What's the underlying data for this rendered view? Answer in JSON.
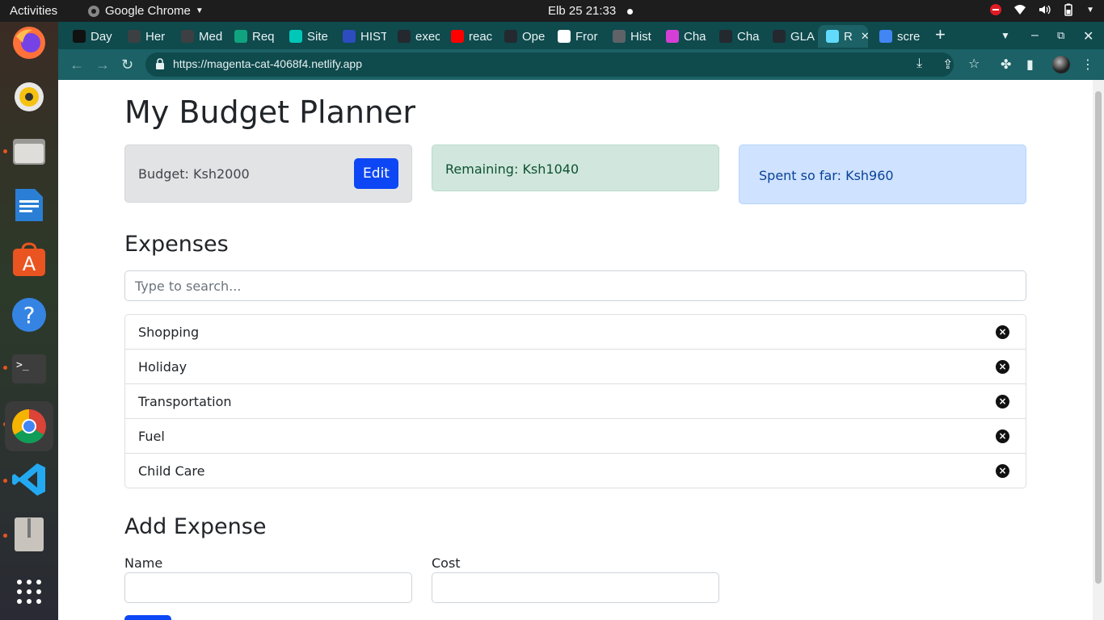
{
  "system": {
    "activities": "Activities",
    "app_name": "Google Chrome",
    "clock": "Elb 25  21:33"
  },
  "tabs": [
    {
      "label": "Day",
      "color": "#111111"
    },
    {
      "label": "Her",
      "color": "#3c4043"
    },
    {
      "label": "Med",
      "color": "#3c4043"
    },
    {
      "label": "Req",
      "color": "#10a37f"
    },
    {
      "label": "Site",
      "color": "#00c7b7"
    },
    {
      "label": "HIST",
      "color": "#2c4cbf"
    },
    {
      "label": "exec",
      "color": "#24292f"
    },
    {
      "label": "reac",
      "color": "#ff0000"
    },
    {
      "label": "Ope",
      "color": "#24292f"
    },
    {
      "label": "Fror",
      "color": "#ffffff"
    },
    {
      "label": "Hist",
      "color": "#5f6368"
    },
    {
      "label": "Cha",
      "color": "#d63fd6"
    },
    {
      "label": "Cha",
      "color": "#24292f"
    },
    {
      "label": "GLA",
      "color": "#24292f"
    },
    {
      "label": "R",
      "color": "#61dafb"
    },
    {
      "label": "scre",
      "color": "#4285f4"
    }
  ],
  "toolbar": {
    "url": "https://magenta-cat-4068f4.netlify.app"
  },
  "page": {
    "title": "My Budget Planner",
    "budget_text": "Budget: Ksh2000",
    "edit_label": "Edit",
    "remaining_text": "Remaining: Ksh1040",
    "spent_text": "Spent so far: Ksh960",
    "expenses_heading": "Expenses",
    "search_placeholder": "Type to search...",
    "expenses": [
      {
        "name": "Shopping"
      },
      {
        "name": "Holiday"
      },
      {
        "name": "Transportation"
      },
      {
        "name": "Fuel"
      },
      {
        "name": "Child Care"
      }
    ],
    "add_heading": "Add Expense",
    "name_label": "Name",
    "cost_label": "Cost"
  }
}
